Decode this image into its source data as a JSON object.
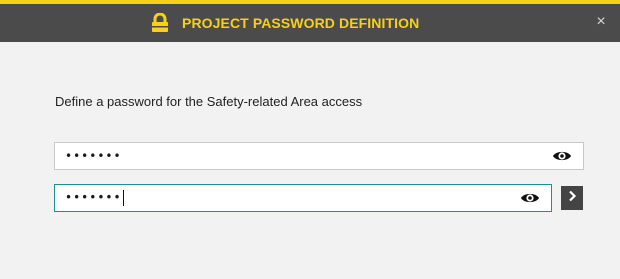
{
  "dialog": {
    "title": "PROJECT PASSWORD DEFINITION",
    "close_label": "×",
    "title_icon": "lock-icon",
    "close_icon": "close-icon"
  },
  "instruction": "Define a password for the Safety-related Area access",
  "password_fields": [
    {
      "value": "•••••••",
      "focused": false,
      "toggle_icon": "eye-icon"
    },
    {
      "value": "•••••••",
      "focused": true,
      "toggle_icon": "eye-icon"
    }
  ],
  "submit_icon": "chevron-right-icon",
  "colors": {
    "accent": "#f7d117",
    "titlebar": "#4b4b4b",
    "focus_border": "#1f8f9a",
    "button": "#444444"
  }
}
